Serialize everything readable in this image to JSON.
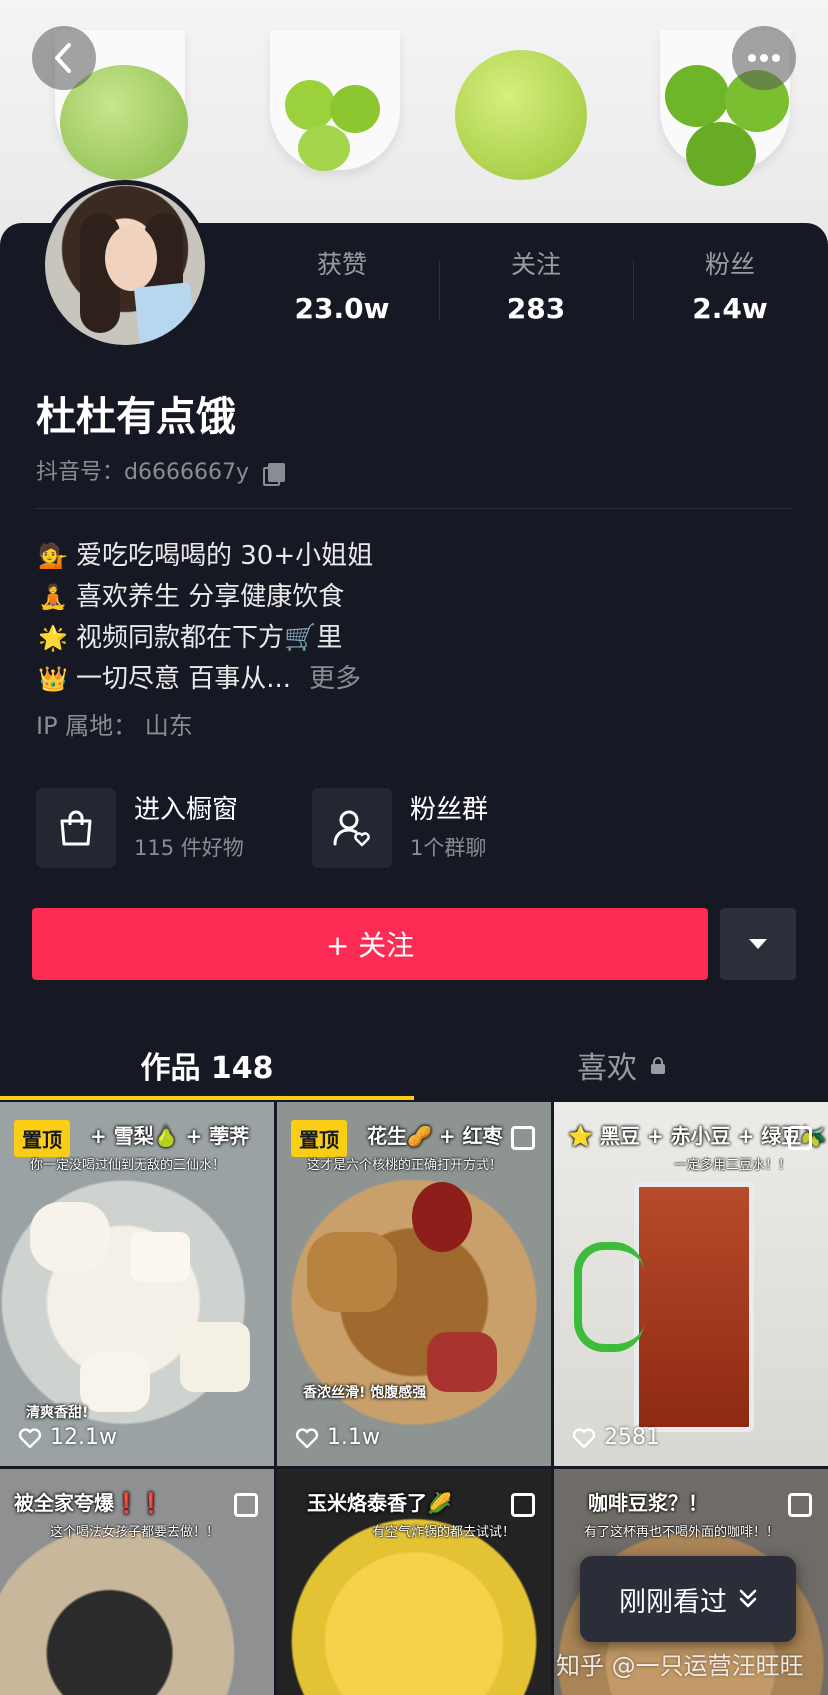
{
  "header": {
    "back_icon": "chevron-left-icon",
    "more_icon": "more-dots-icon"
  },
  "stats": [
    {
      "label": "获赞",
      "value": "23.0w"
    },
    {
      "label": "关注",
      "value": "283"
    },
    {
      "label": "粉丝",
      "value": "2.4w"
    }
  ],
  "profile": {
    "nickname": "杜杜有点饿",
    "douyin_id_label": "抖音号：",
    "douyin_id": "d6666667y",
    "bio": [
      {
        "emoji": "💁",
        "text": "爱吃吃喝喝的 30+小姐姐"
      },
      {
        "emoji": "🧘",
        "text": "喜欢养生 分享健康饮食"
      },
      {
        "emoji": "🌟",
        "text": "视频同款都在下方🛒里"
      },
      {
        "emoji": "👑",
        "text": "一切尽意 百事从..."
      }
    ],
    "more_label": "更多",
    "ip": "IP 属地：  山东"
  },
  "entries": {
    "shop": {
      "title": "进入橱窗",
      "subtitle": "115 件好物",
      "icon": "shopping-bag-icon"
    },
    "fans": {
      "title": "粉丝群",
      "subtitle": "1个群聊",
      "icon": "fan-group-icon"
    }
  },
  "follow": {
    "label": "+ 关注"
  },
  "tabs": {
    "works": "作品 148",
    "likes": "喜欢"
  },
  "videos": [
    {
      "pinned_label": "置顶",
      "caption": "+ 雪梨🍐 + 荸荠",
      "subcaption": "你一定没喝过仙到无敌的三仙水！",
      "overlay": "清爽香甜!",
      "likes": "12.1w"
    },
    {
      "pinned_label": "置顶",
      "caption": "花生🥜 + 红枣",
      "subcaption": "这才是六个核桃的正确打开方式！",
      "overlay": "香浓丝滑! 饱腹感强",
      "likes": "1.1w"
    },
    {
      "pinned_label": "",
      "caption": "⭐ 黑豆 + 赤小豆 + 绿豆🫒",
      "subcaption": "一定多用三豆水！！",
      "overlay": "",
      "likes": "2581"
    },
    {
      "pinned_label": "",
      "caption": "被全家夸爆❗❗",
      "subcaption": "这个喝法女孩子都要去做！！",
      "overlay": "",
      "likes": ""
    },
    {
      "pinned_label": "",
      "caption": "玉米烙泰香了🌽",
      "subcaption": "有空气炸锅的都去试试！",
      "overlay": "",
      "likes": ""
    },
    {
      "pinned_label": "",
      "caption": "咖啡豆浆？！",
      "subcaption": "有了这杯再也不喝外面的咖啡！！",
      "overlay": "",
      "likes": ""
    }
  ],
  "recent_button": "刚刚看过",
  "watermark": "知乎 @一只运营汪旺旺",
  "colors": {
    "accent": "#fe2c55",
    "tab_underline": "#face15",
    "background": "#161823"
  }
}
